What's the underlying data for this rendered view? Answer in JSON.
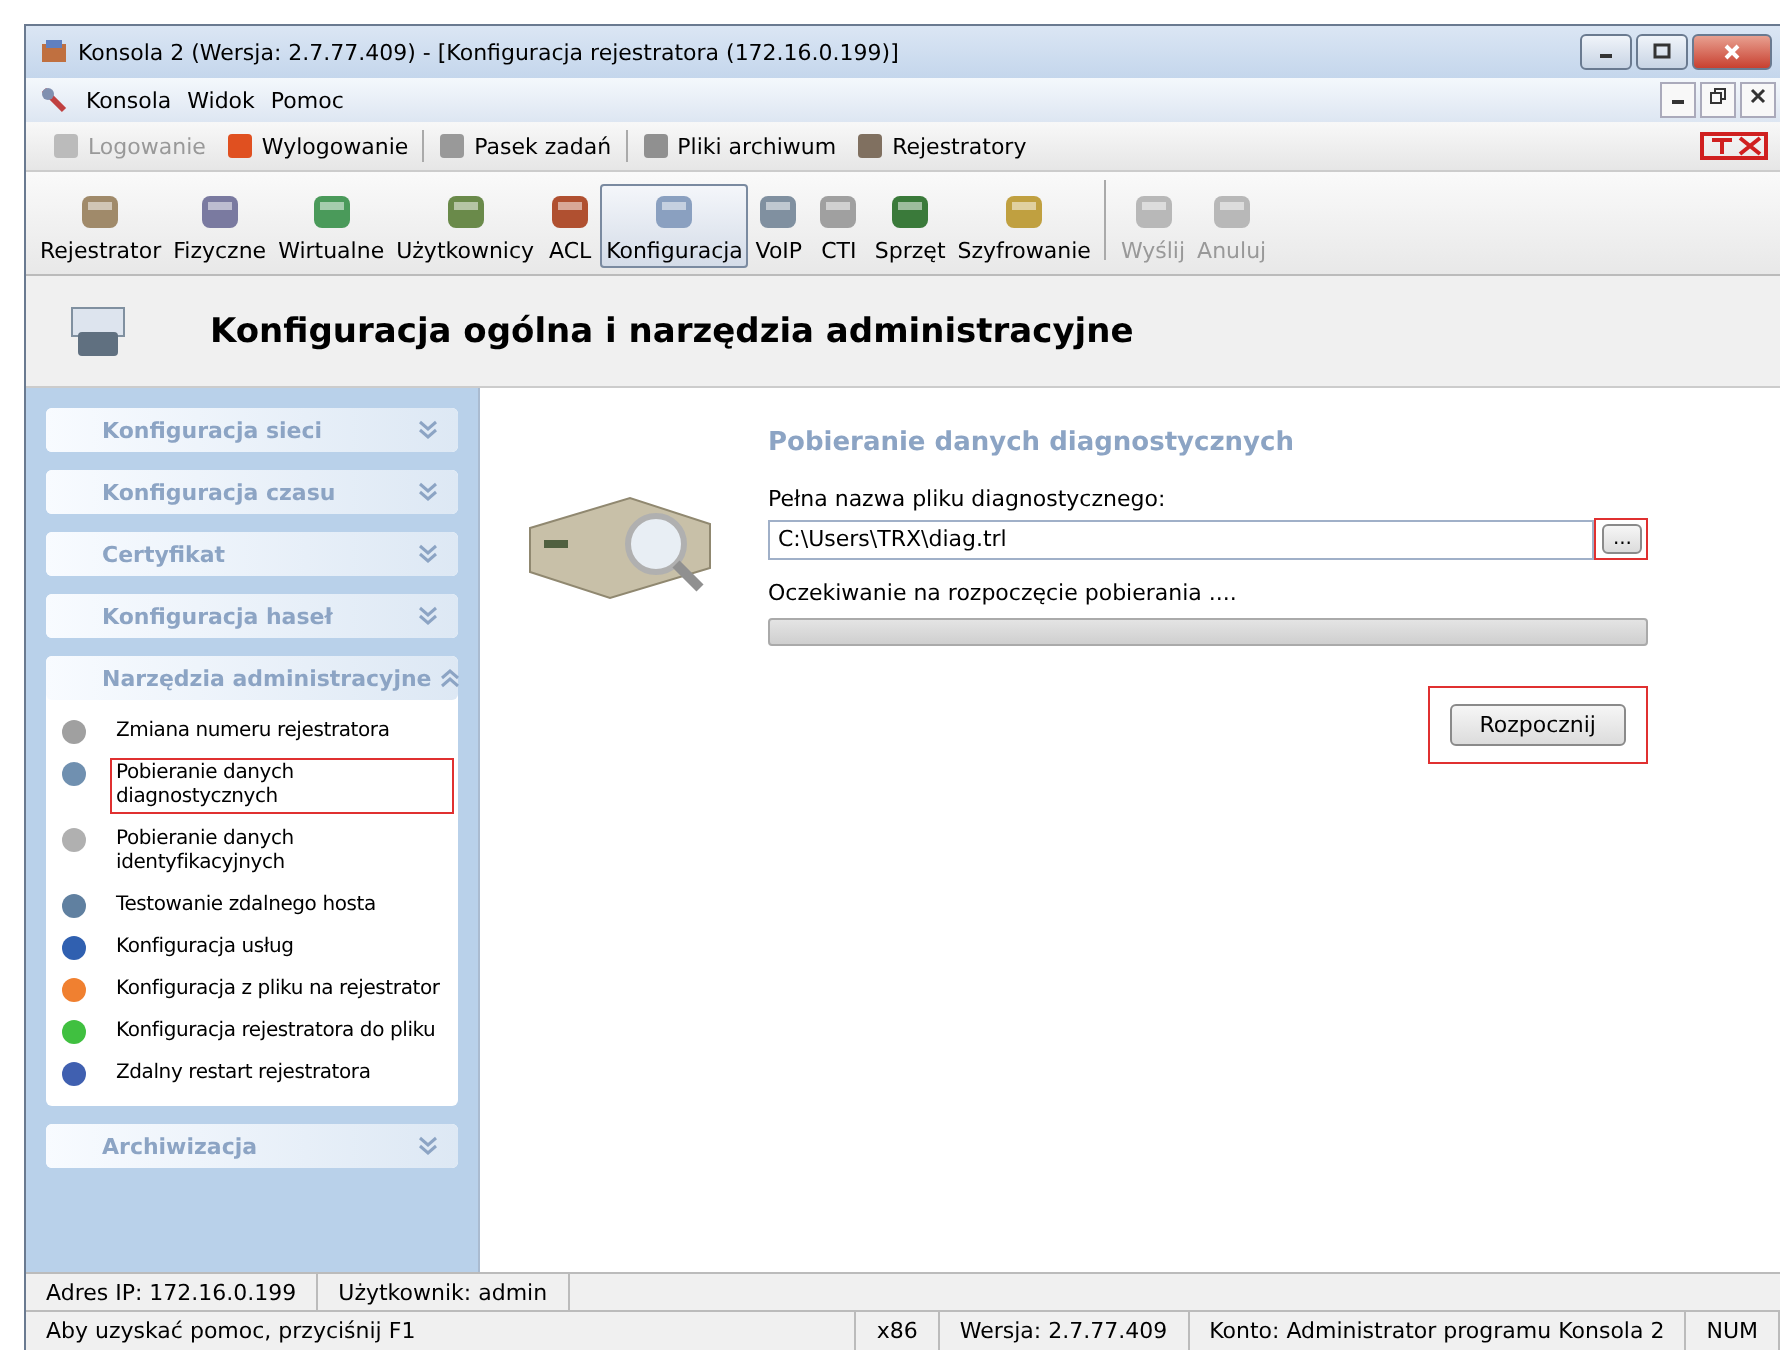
{
  "window": {
    "title": "Konsola 2 (Wersja:  2.7.77.409) - [Konfiguracja rejestratora (172.16.0.199)]"
  },
  "menu": [
    "Konsola",
    "Widok",
    "Pomoc"
  ],
  "quickbar": [
    {
      "label": "Logowanie",
      "disabled": true
    },
    {
      "label": "Wylogowanie",
      "disabled": false
    },
    {
      "label": "Pasek zadań",
      "disabled": false
    },
    {
      "label": "Pliki archiwum",
      "disabled": false
    },
    {
      "label": "Rejestratory",
      "disabled": false
    }
  ],
  "toolbar": [
    {
      "label": "Rejestrator",
      "selected": false,
      "disabled": false
    },
    {
      "label": "Fizyczne",
      "selected": false,
      "disabled": false
    },
    {
      "label": "Wirtualne",
      "selected": false,
      "disabled": false
    },
    {
      "label": "Użytkownicy",
      "selected": false,
      "disabled": false
    },
    {
      "label": "ACL",
      "selected": false,
      "disabled": false
    },
    {
      "label": "Konfiguracja",
      "selected": true,
      "disabled": false
    },
    {
      "label": "VoIP",
      "selected": false,
      "disabled": false
    },
    {
      "label": "CTI",
      "selected": false,
      "disabled": false
    },
    {
      "label": "Sprzęt",
      "selected": false,
      "disabled": false
    },
    {
      "label": "Szyfrowanie",
      "selected": false,
      "disabled": false
    },
    {
      "label": "Wyślij",
      "selected": false,
      "disabled": true
    },
    {
      "label": "Anuluj",
      "selected": false,
      "disabled": true
    }
  ],
  "header": {
    "title": "Konfiguracja ogólna i narzędzia administracyjne"
  },
  "sidebar": {
    "sections": [
      {
        "title": "Konfiguracja sieci",
        "expanded": false
      },
      {
        "title": "Konfiguracja czasu",
        "expanded": false
      },
      {
        "title": "Certyfikat",
        "expanded": false
      },
      {
        "title": "Konfiguracja haseł",
        "expanded": false
      },
      {
        "title": "Narzędzia administracyjne",
        "expanded": true,
        "items": [
          {
            "label": "Zmiana numeru rejestratora",
            "highlighted": false
          },
          {
            "label": "Pobieranie danych diagnostycznych",
            "highlighted": true
          },
          {
            "label": "Pobieranie danych identyfikacyjnych",
            "highlighted": false
          },
          {
            "label": "Testowanie zdalnego hosta",
            "highlighted": false
          },
          {
            "label": "Konfiguracja usług",
            "highlighted": false
          },
          {
            "label": "Konfiguracja z pliku na rejestrator",
            "highlighted": false
          },
          {
            "label": "Konfiguracja rejestratora do pliku",
            "highlighted": false
          },
          {
            "label": "Zdalny restart rejestratora",
            "highlighted": false
          }
        ]
      },
      {
        "title": "Archiwizacja",
        "expanded": false
      }
    ]
  },
  "panel": {
    "title": "Pobieranie danych diagnostycznych",
    "file_label": "Pełna nazwa pliku diagnostycznego:",
    "file_value": "C:\\Users\\TRX\\diag.trl",
    "browse": {
      "label": "...",
      "highlighted": true
    },
    "status": "Oczekiwanie na rozpoczęcie pobierania ....",
    "progress": {
      "level": 0
    },
    "start": {
      "label": "Rozpocznij",
      "highlighted": true
    }
  },
  "status_bar": {
    "top": [
      "Adres IP: 172.16.0.199",
      "Użytkownik: admin"
    ],
    "bottom": [
      "Aby uzyskać pomoc, przyciśnij F1",
      "x86",
      "Wersja: 2.7.77.409",
      "Konto: Administrator programu Konsola 2",
      "NUM"
    ]
  }
}
